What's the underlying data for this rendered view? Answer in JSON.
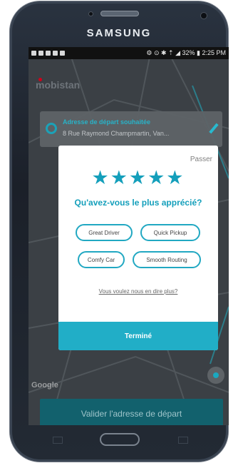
{
  "device": {
    "brand": "SAMSUNG"
  },
  "status_bar": {
    "right": "⚙ ⊙ ✱ ⇡ ◢ 32% ▮ 2:25 PM"
  },
  "app": {
    "logo": "mobistan"
  },
  "address_card": {
    "title": "Adresse de départ souhaitée",
    "line": "8 Rue Raymond Champmartin, Van..."
  },
  "map": {
    "attribution": "Google"
  },
  "rating_modal": {
    "skip_label": "Passer",
    "stars": "★★★★★",
    "question": "Qu'avez-vous le plus apprécié?",
    "chips": [
      "Great Driver",
      "Quick Pickup",
      "Comfy Car",
      "Smooth Routing"
    ],
    "more_link": "Vous voulez nous en dire plus?",
    "done_label": "Terminé"
  },
  "footer": {
    "validate_label": "Valider l'adresse de départ"
  }
}
